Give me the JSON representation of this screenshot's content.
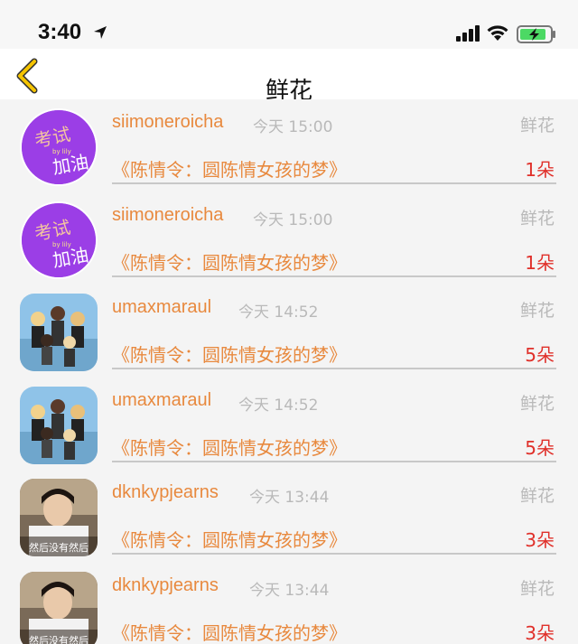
{
  "status_bar": {
    "time": "3:40"
  },
  "nav": {
    "title": "鲜花"
  },
  "rows": [
    {
      "username": "siimoneroicha",
      "time": "今天 15:00",
      "tag": "鲜花",
      "book": "《陈情令：圆陈情女孩的梦》",
      "count": "1朵",
      "avatar_text_1": "考试",
      "avatar_text_2": "加油",
      "avatar_text_mid": "by lily"
    },
    {
      "username": "siimoneroicha",
      "time": "今天 15:00",
      "tag": "鲜花",
      "book": "《陈情令：圆陈情女孩的梦》",
      "count": "1朵",
      "avatar_text_1": "考试",
      "avatar_text_2": "加油",
      "avatar_text_mid": "by lily"
    },
    {
      "username": "umaxmaraul",
      "time": "今天 14:52",
      "tag": "鲜花",
      "book": "《陈情令：圆陈情女孩的梦》",
      "count": "5朵"
    },
    {
      "username": "umaxmaraul",
      "time": "今天 14:52",
      "tag": "鲜花",
      "book": "《陈情令：圆陈情女孩的梦》",
      "count": "5朵"
    },
    {
      "username": "dknkypjearns",
      "time": "今天 13:44",
      "tag": "鲜花",
      "book": "《陈情令：圆陈情女孩的梦》",
      "count": "3朵",
      "avatar_caption": "然后没有然后"
    },
    {
      "username": "dknkypjearns",
      "time": "今天 13:44",
      "tag": "鲜花",
      "book": "《陈情令：圆陈情女孩的梦》",
      "count": "3朵",
      "avatar_caption": "然后没有然后"
    }
  ],
  "colors": {
    "username": "#e8893e",
    "count": "#e0302a",
    "meta": "#b9b9b9",
    "accent_back": "#f5c400"
  },
  "icons": [
    "location-arrow-icon",
    "signal-icon",
    "wifi-icon",
    "battery-charging-icon",
    "back-chevron-icon"
  ]
}
